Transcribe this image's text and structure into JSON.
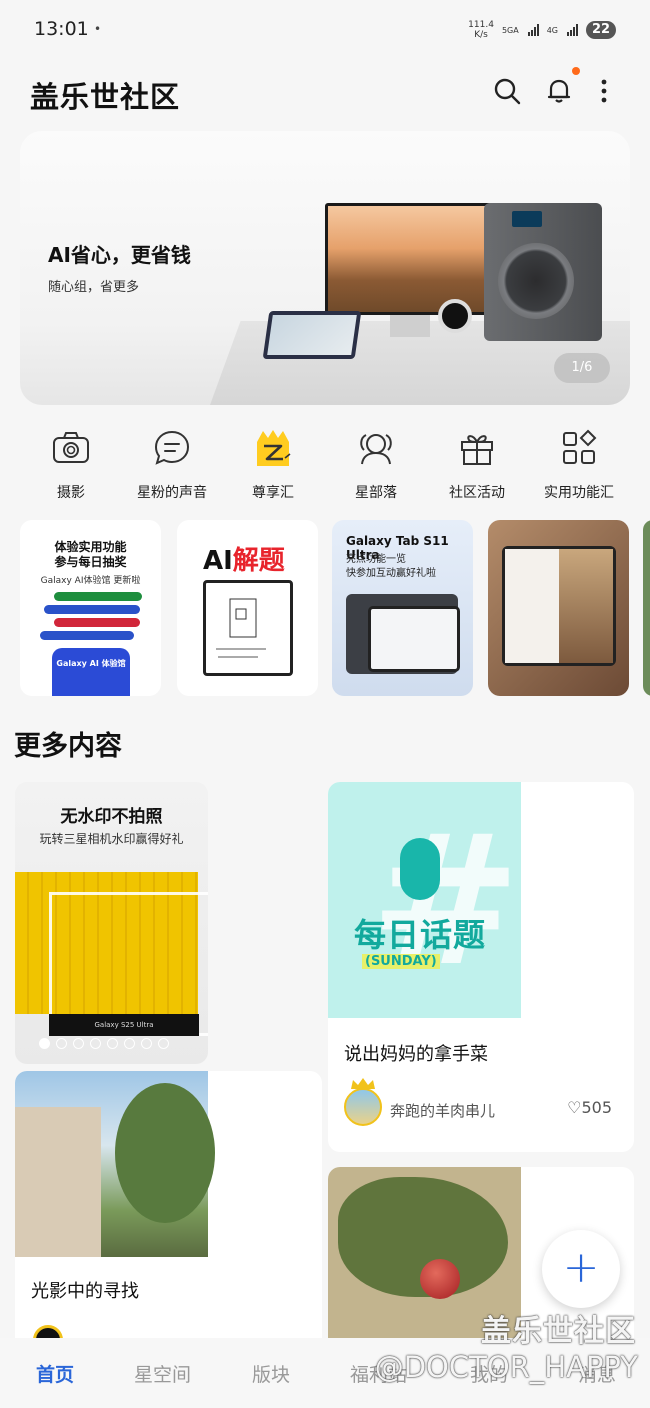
{
  "status_bar": {
    "time": "13:01",
    "dot": "•",
    "net_speed_value": "111.4",
    "net_speed_unit": "K/s",
    "signal1_label": "5GA",
    "signal2_label": "4G",
    "battery": "22"
  },
  "header": {
    "title": "盖乐世社区"
  },
  "banner": {
    "title": "AI省心，更省钱",
    "subtitle": "随心组，省更多",
    "page_indicator": "1/6"
  },
  "shortcuts": [
    {
      "label": "摄影",
      "icon": "camera-icon"
    },
    {
      "label": "星粉的声音",
      "icon": "chat-bubble-icon"
    },
    {
      "label": "尊享汇",
      "icon": "crown-z-icon"
    },
    {
      "label": "星部落",
      "icon": "people-icon"
    },
    {
      "label": "社区活动",
      "icon": "gift-icon"
    },
    {
      "label": "实用功能汇",
      "icon": "apps-grid-icon"
    }
  ],
  "promos": {
    "card1": {
      "title_line1": "体验实用功能",
      "title_line2": "参与每日抽奖",
      "subtitle": "Galaxy AI体验馆 更新啦",
      "phone_text": "Galaxy AI 体验馆"
    },
    "card2": {
      "title_prefix": "AI",
      "title_accent": "解题"
    },
    "card3": {
      "title": "Galaxy Tab S11 Ultra",
      "subtitle1": "亮点功能一览",
      "subtitle2": "快参加互动赢好礼啦"
    }
  },
  "more_content": {
    "title": "更多内容",
    "card_a": {
      "title": "无水印不拍照",
      "subtitle": "玩转三星相机水印赢得好礼",
      "caption": "Galaxy S25 Ultra"
    },
    "card_b": {
      "image_title": "每日话题",
      "image_tag": "(SUNDAY)",
      "text": "说出妈妈的拿手菜",
      "user": "奔跑的羊肉串儿",
      "likes": "505"
    },
    "card_c": {
      "text": "光影中的寻找"
    }
  },
  "fab": {
    "label": "+"
  },
  "bottom_nav": {
    "items": [
      "首页",
      "星空间",
      "版块",
      "福利站",
      "我的",
      "消息"
    ],
    "active_index": 0
  },
  "watermark": {
    "line1": "盖乐世社区",
    "line2": "@DOCTOR_HAPPY"
  },
  "colors": {
    "accent": "#2a66d8",
    "notification": "#ff6a1a",
    "topic_teal": "#12a99d"
  }
}
